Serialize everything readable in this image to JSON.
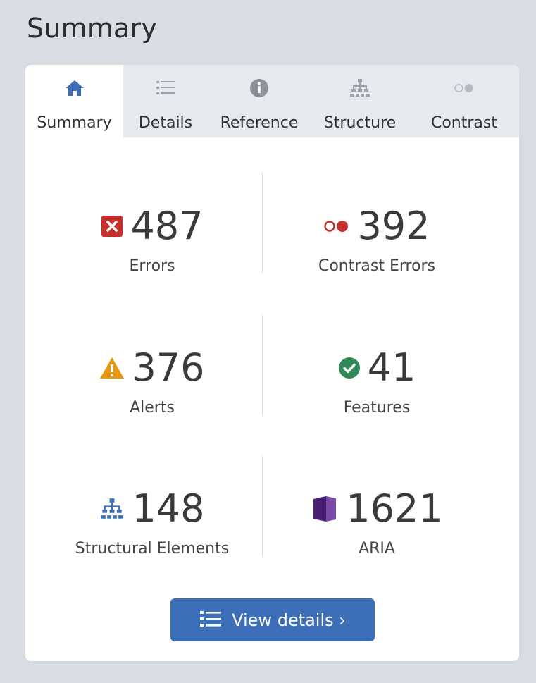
{
  "header": {
    "title": "Summary"
  },
  "tabs": [
    {
      "label": "Summary",
      "icon": "home-icon",
      "active": true
    },
    {
      "label": "Details",
      "icon": "list-icon",
      "active": false
    },
    {
      "label": "Reference",
      "icon": "info-icon",
      "active": false
    },
    {
      "label": "Structure",
      "icon": "hierarchy-icon",
      "active": false
    },
    {
      "label": "Contrast",
      "icon": "contrast-icon",
      "active": false
    }
  ],
  "stats": {
    "errors": {
      "value": "487",
      "label": "Errors",
      "icon": "error-icon",
      "color": "#c4302b"
    },
    "contrast_errors": {
      "value": "392",
      "label": "Contrast Errors",
      "icon": "contrast-error-icon",
      "color": "#c4302b"
    },
    "alerts": {
      "value": "376",
      "label": "Alerts",
      "icon": "alert-icon",
      "color": "#e8950f"
    },
    "features": {
      "value": "41",
      "label": "Features",
      "icon": "check-icon",
      "color": "#2f8a57"
    },
    "structural": {
      "value": "148",
      "label": "Structural Elements",
      "icon": "structure-icon",
      "color": "#3d6fb8"
    },
    "aria": {
      "value": "1621",
      "label": "ARIA",
      "icon": "aria-icon",
      "color": "#5b2d86"
    }
  },
  "actions": {
    "view_details_label": "View details ›"
  },
  "colors": {
    "accent": "#3d6fb8",
    "background": "#d8dde3",
    "tab_bar": "#e6e9ee"
  }
}
